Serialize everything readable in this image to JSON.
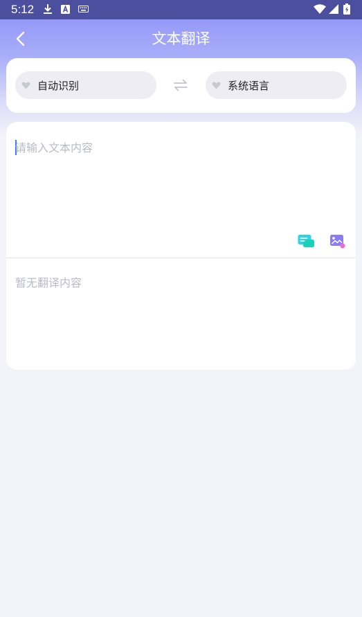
{
  "status_bar": {
    "time": "5:12",
    "icons": [
      "download-icon",
      "text-a-icon",
      "keyboard-icon",
      "wifi-icon",
      "signal-icon",
      "battery-icon"
    ]
  },
  "header": {
    "title": "文本翻译",
    "back_icon": "chevron-left-icon"
  },
  "languages": {
    "source": "自动识别",
    "target": "系统语言",
    "swap_icon": "swap-arrows-icon",
    "dropdown_icon": "dropdown-heart-icon"
  },
  "translator": {
    "input_placeholder": "请输入文本内容",
    "input_value": "",
    "tools": [
      "text-chat-icon",
      "image-icon"
    ],
    "result_placeholder": "暂无翻译内容"
  },
  "colors": {
    "status_bar": "#4c4f9e",
    "header_gradient_top": "#8b8ff7",
    "background": "#f3f4f9",
    "pill": "#ededf3",
    "placeholder": "#b9bac8",
    "cursor": "#3d7bff",
    "accent_cyan": "#2ad4e6",
    "accent_purple": "#8a7cf2"
  }
}
